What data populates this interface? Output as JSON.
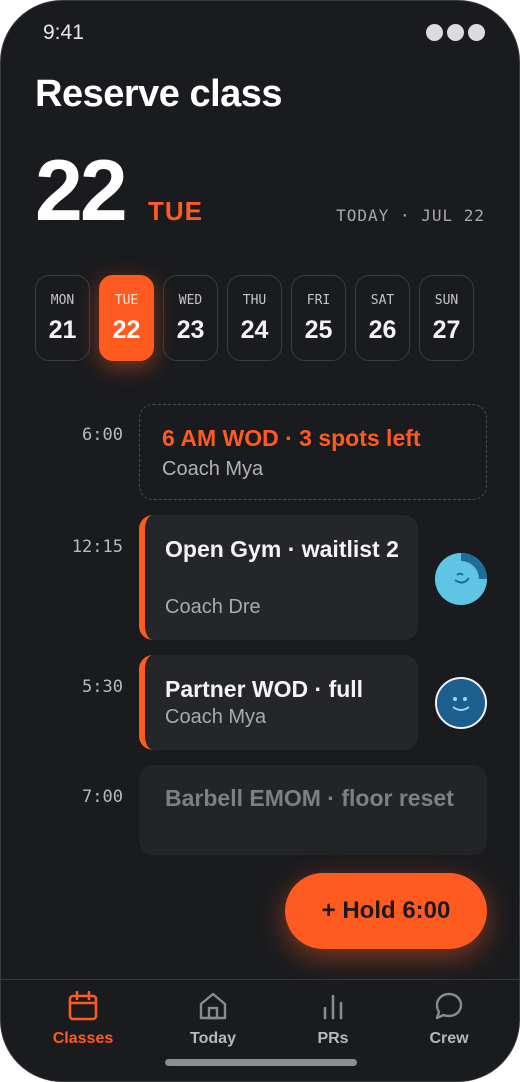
{
  "status": {
    "time": "9:41"
  },
  "header": {
    "title": "Reserve class",
    "big_day": "22",
    "big_dow": "TUE",
    "today_label": "TODAY · JUL 22"
  },
  "week": [
    {
      "dow": "MON",
      "num": "21"
    },
    {
      "dow": "TUE",
      "num": "22",
      "active": true
    },
    {
      "dow": "WED",
      "num": "23"
    },
    {
      "dow": "THU",
      "num": "24"
    },
    {
      "dow": "FRI",
      "num": "25"
    },
    {
      "dow": "SAT",
      "num": "26"
    },
    {
      "dow": "SUN",
      "num": "27"
    }
  ],
  "classes": [
    {
      "time": "6:00",
      "title": "6 AM WOD · 3 spots left",
      "coach": "Coach Mya"
    },
    {
      "time": "12:15",
      "title": "Open Gym · waitlist 2",
      "coach": "Coach Dre"
    },
    {
      "time": "5:30",
      "title": "Partner WOD · full",
      "coach": "Coach Mya"
    },
    {
      "time": "7:00",
      "title": "Barbell EMOM · floor reset"
    }
  ],
  "fab": {
    "label": "+ Hold 6:00"
  },
  "nav": [
    {
      "label": "Classes",
      "icon": "calendar-icon",
      "active": true
    },
    {
      "label": "Today",
      "icon": "home-icon"
    },
    {
      "label": "PRs",
      "icon": "bar-chart-icon"
    },
    {
      "label": "Crew",
      "icon": "chat-bubble-icon"
    }
  ],
  "colors": {
    "accent": "#ff5a1f",
    "background": "#1a1b1e",
    "card": "#24262a"
  }
}
